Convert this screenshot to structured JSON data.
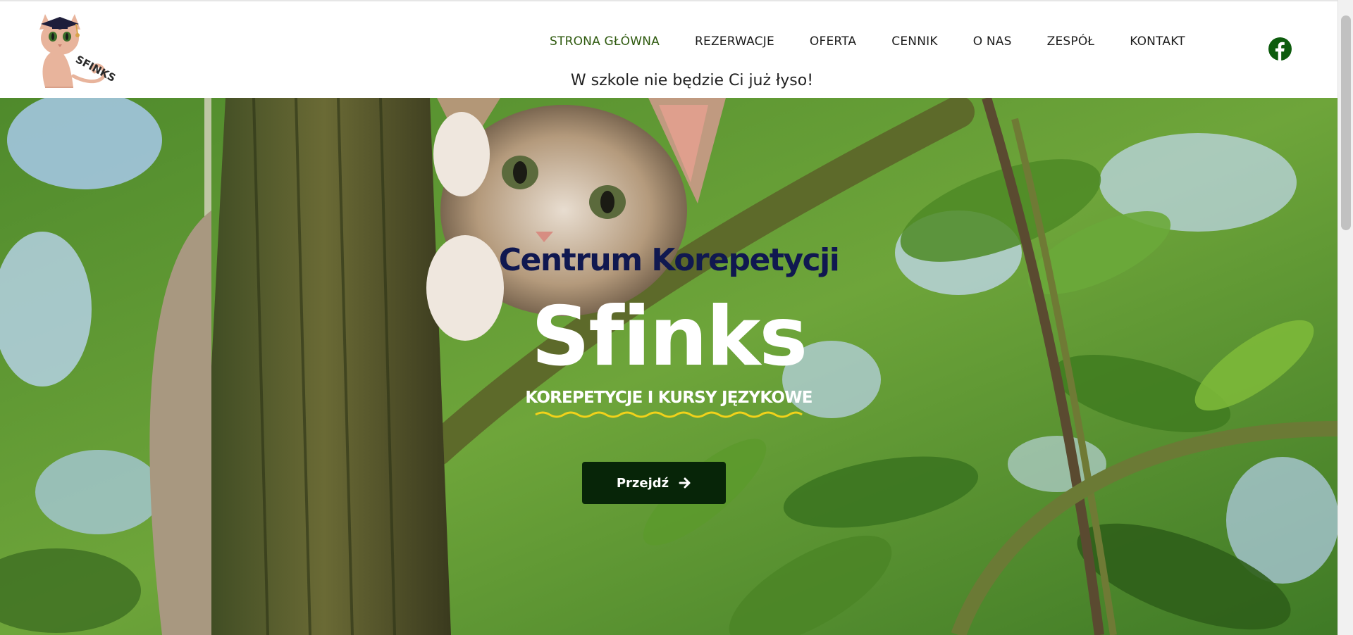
{
  "header": {
    "logo_text": "SFINKS",
    "nav": [
      {
        "label": "STRONA GŁÓWNA",
        "active": true
      },
      {
        "label": "REZERWACJE",
        "active": false
      },
      {
        "label": "OFERTA",
        "active": false
      },
      {
        "label": "CENNIK",
        "active": false
      },
      {
        "label": "O NAS",
        "active": false
      },
      {
        "label": "ZESPÓŁ",
        "active": false
      },
      {
        "label": "KONTAKT",
        "active": false
      }
    ],
    "social_icon": "facebook-icon",
    "tagline": "W szkole nie będzie Ci już łyso!"
  },
  "hero": {
    "pretitle": "Centrum Korepetycji",
    "title": "Sfinks",
    "subtitle": "KOREPETYCJE I KURSY JĘZYKOWE",
    "cta_label": "Przejdź",
    "cta_icon": "arrow-right-icon",
    "background": "kitten-in-tree-photo"
  },
  "colors": {
    "nav_active": "#2f5a0f",
    "pretitle": "#101850",
    "cta_bg": "#072508",
    "wave": "#f2d21a",
    "facebook": "#0d5c0d"
  }
}
